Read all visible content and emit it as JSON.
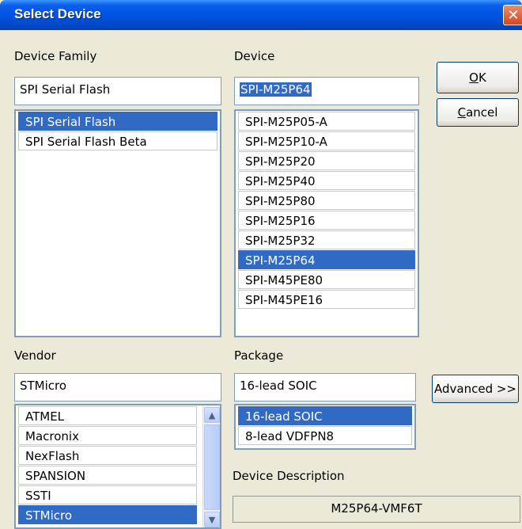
{
  "window": {
    "title": "Select Device",
    "close_glyph": "✕"
  },
  "family": {
    "label": "Device Family",
    "value": "SPI Serial Flash",
    "items": [
      "SPI Serial Flash",
      "SPI Serial Flash Beta"
    ],
    "selected": "SPI Serial Flash"
  },
  "device": {
    "label": "Device",
    "value": "SPI-M25P64",
    "items": [
      "SPI-M25P05-A",
      "SPI-M25P10-A",
      "SPI-M25P20",
      "SPI-M25P40",
      "SPI-M25P80",
      "SPI-M25P16",
      "SPI-M25P32",
      "SPI-M25P64",
      "SPI-M45PE80",
      "SPI-M45PE16"
    ],
    "selected": "SPI-M25P64"
  },
  "vendor": {
    "label": "Vendor",
    "value": "STMicro",
    "items": [
      "ATMEL",
      "Macronix",
      "NexFlash",
      "SPANSION",
      "SSTI",
      "STMicro"
    ],
    "selected": "STMicro"
  },
  "package": {
    "label": "Package",
    "value": "16-lead SOIC",
    "items": [
      "16-lead SOIC",
      "8-lead VDFPN8"
    ],
    "selected": "16-lead SOIC"
  },
  "description": {
    "label": "Device Description",
    "value": "M25P64-VMF6T"
  },
  "buttons": {
    "ok_mnemonic": "O",
    "ok_rest": "K",
    "cancel_mnemonic": "C",
    "cancel_rest": "ancel",
    "advanced": "Advanced >>"
  },
  "icons": {
    "scroll_up": "up-arrow-icon",
    "scroll_down": "down-arrow-icon",
    "close": "close-icon"
  },
  "colors": {
    "selection": "#316AC5",
    "title_bar": "#0054E3",
    "dialog_bg": "#ECE9D8"
  }
}
